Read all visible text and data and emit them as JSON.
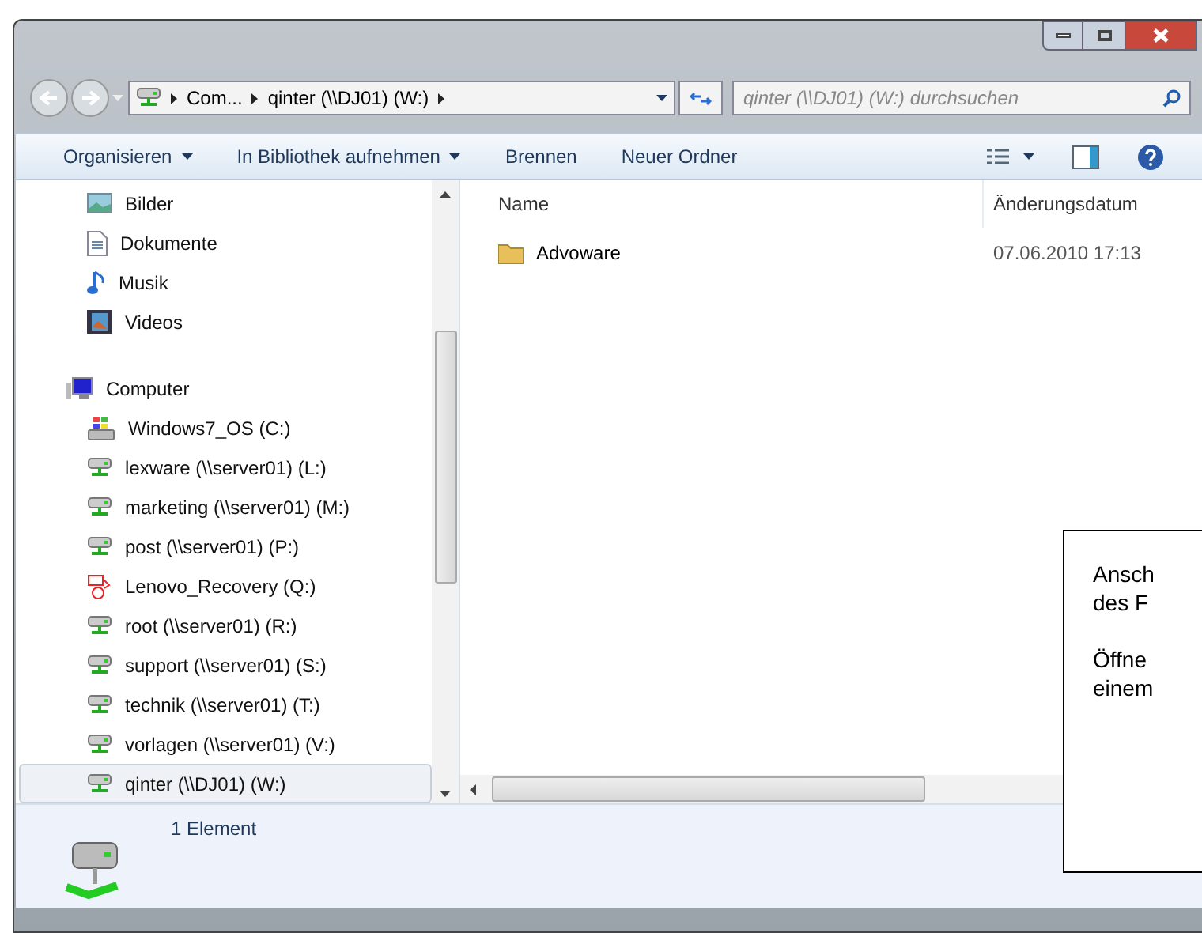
{
  "breadcrumb": [
    "Com...",
    "qinter (\\\\DJ01) (W:)"
  ],
  "search": {
    "placeholder": "qinter (\\\\DJ01) (W:) durchsuchen"
  },
  "toolbar": [
    {
      "label": "Organisieren",
      "dropdown": true
    },
    {
      "label": "In Bibliothek aufnehmen",
      "dropdown": true
    },
    {
      "label": "Brennen",
      "dropdown": false
    },
    {
      "label": "Neuer Ordner",
      "dropdown": false
    }
  ],
  "sidebar": {
    "items": [
      {
        "kind": "pictures",
        "label": "Bilder",
        "selected": false
      },
      {
        "kind": "documents",
        "label": "Dokumente",
        "selected": false
      },
      {
        "kind": "music",
        "label": "Musik",
        "selected": false
      },
      {
        "kind": "videos",
        "label": "Videos",
        "selected": false
      },
      {
        "kind": "gap"
      },
      {
        "kind": "computer",
        "label": "Computer",
        "selected": false
      },
      {
        "kind": "system",
        "label": "Windows7_OS (C:)",
        "selected": false
      },
      {
        "kind": "network",
        "label": "lexware (\\\\server01) (L:)",
        "selected": false
      },
      {
        "kind": "network",
        "label": "marketing (\\\\server01) (M:)",
        "selected": false
      },
      {
        "kind": "network",
        "label": "post (\\\\server01) (P:)",
        "selected": false
      },
      {
        "kind": "recovery",
        "label": "Lenovo_Recovery (Q:)",
        "selected": false
      },
      {
        "kind": "network",
        "label": "root (\\\\server01) (R:)",
        "selected": false
      },
      {
        "kind": "network",
        "label": "support (\\\\server01) (S:)",
        "selected": false
      },
      {
        "kind": "network",
        "label": "technik (\\\\server01) (T:)",
        "selected": false
      },
      {
        "kind": "network",
        "label": "vorlagen (\\\\server01) (V:)",
        "selected": false
      },
      {
        "kind": "network",
        "label": "qinter (\\\\DJ01) (W:)",
        "selected": true
      }
    ]
  },
  "table": {
    "columns": [
      "Name",
      "Änderungsdatum"
    ],
    "rows": [
      {
        "name": "Advoware",
        "date": "07.06.2010 17:13",
        "selected": false
      }
    ]
  },
  "status_bar": {
    "count": "1 Element"
  },
  "callout": [
    [
      "Ansch",
      "des F"
    ],
    [
      "Öffne",
      "einem"
    ]
  ]
}
